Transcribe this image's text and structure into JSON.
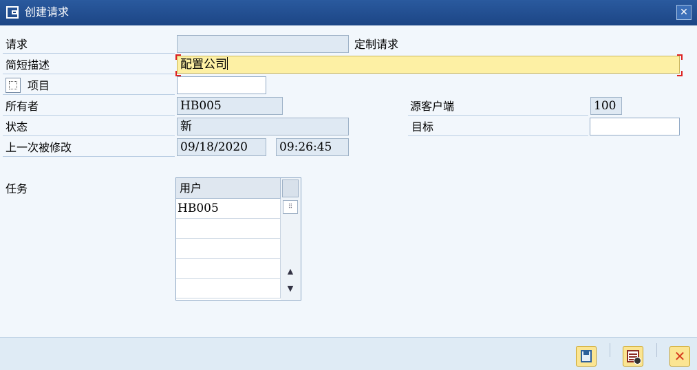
{
  "window": {
    "title": "创建请求",
    "close_glyph": "✕"
  },
  "form": {
    "request_label": "请求",
    "request_value": "",
    "request_type": "定制请求",
    "short_desc_label": "简短描述",
    "short_desc_value": "配置公司",
    "project_label": "项目",
    "project_value": "",
    "owner_label": "所有者",
    "owner_value": "HB005",
    "source_client_label": "源客户端",
    "source_client_value": "100",
    "status_label": "状态",
    "status_value": "新",
    "target_label": "目标",
    "target_value": "",
    "last_changed_label": "上一次被修改",
    "last_changed_date": "09/18/2020",
    "last_changed_time": "09:26:45"
  },
  "tasks": {
    "label": "任务",
    "column_header": "用户",
    "rows": [
      "HB005",
      "",
      "",
      "",
      ""
    ]
  },
  "icons": {
    "title": "window-icon",
    "project": "document-icon",
    "save": "save-icon",
    "list": "list-icon",
    "cancel": "cancel-icon"
  },
  "colors": {
    "titlebar": "#1c4585",
    "active_field": "#fdf0a4",
    "cancel": "#d63b1e"
  }
}
